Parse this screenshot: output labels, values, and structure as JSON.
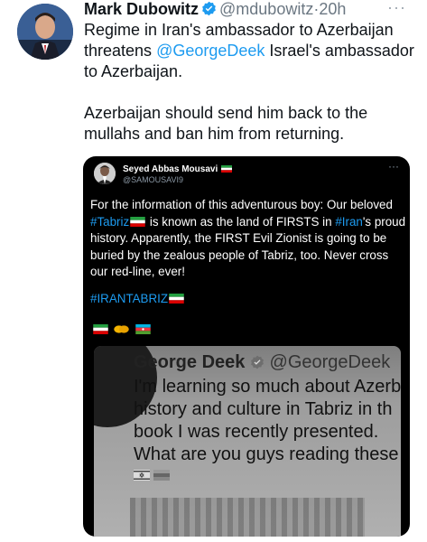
{
  "tweet": {
    "author_name": "Mark Dubowitz",
    "author_handle": "@mdubowitz",
    "separator": "·",
    "time": "20h",
    "more": "···",
    "body_p1_a": "Regime in Iran's ambassador to Azerbaijan threatens ",
    "body_p1_mention": "@GeorgeDeek",
    "body_p1_b": " Israel's ambassador to Azerbaijan.",
    "body_p2": "Azerbaijan should send him back to the mullahs and ban him from returning."
  },
  "quoted": {
    "author_name": "Seyed Abbas Mousavi",
    "author_handle": "@SAMOUSAVI9",
    "more": "···",
    "text_a": "For the information of this adventurous boy: Our beloved ",
    "hashtag_tabriz": "#Tabriz",
    "text_b": " is known as the land of FIRSTS in ",
    "hashtag_iran": "#Iran",
    "text_c": "'s proud history.  Apparently, the FIRST Evil Zionist is going to be buried by the zealous people of Tabriz, too. Never cross our red-line, ever!",
    "hashtag_irantabriz": "#IRANTABRIZ",
    "emojis": [
      "iran-flag",
      "handshake",
      "azerbaijan-flag"
    ]
  },
  "screenshot": {
    "author_name": "George Deek",
    "author_handle": "@GeorgeDeek",
    "lines": [
      "I'm learning so much about Azerb",
      "history and culture in Tabriz in th",
      "book I was recently presented.",
      "What are you guys reading these"
    ],
    "emojis": [
      "israel-flag",
      "azerbaijan-flag"
    ]
  },
  "colors": {
    "link": "#1d9bf0",
    "verified": "#1d9bf0",
    "card_bg": "#000000"
  }
}
